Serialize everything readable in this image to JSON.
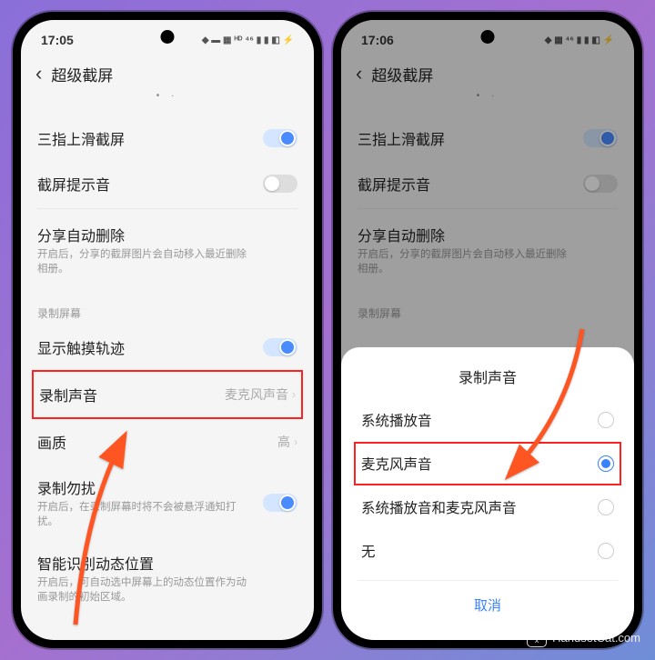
{
  "watermark": "HandsetCat.com",
  "phone1": {
    "time": "17:05",
    "header_title": "超级截屏",
    "rows": {
      "swipe": {
        "label": "三指上滑截屏",
        "on": true
      },
      "sound": {
        "label": "截屏提示音",
        "on": false
      },
      "share_delete": {
        "label": "分享自动删除",
        "desc": "开启后，分享的截屏图片会自动移入最近删除相册。"
      },
      "section": "录制屏幕",
      "trace": {
        "label": "显示触摸轨迹",
        "on": true
      },
      "record_sound": {
        "label": "录制声音",
        "value": "麦克风声音"
      },
      "quality": {
        "label": "画质",
        "value": "高"
      },
      "dnd": {
        "label": "录制勿扰",
        "desc": "开启后，在录制屏幕时将不会被悬浮通知打扰。",
        "on": true
      },
      "smart": {
        "label": "智能识别动态位置",
        "desc": "开启后，可自动选中屏幕上的动态位置作为动画录制的初始区域。"
      }
    }
  },
  "phone2": {
    "time": "17:06",
    "header_title": "超级截屏",
    "rows": {
      "swipe": {
        "label": "三指上滑截屏",
        "on": true
      },
      "sound": {
        "label": "截屏提示音",
        "on": false
      },
      "share_delete": {
        "label": "分享自动删除",
        "desc": "开启后，分享的截屏图片会自动移入最近删除相册。"
      },
      "section": "录制屏幕"
    },
    "sheet": {
      "title": "录制声音",
      "opt1": "系统播放音",
      "opt2": "麦克风声音",
      "opt3": "系统播放音和麦克风声音",
      "opt4": "无",
      "cancel": "取消"
    }
  }
}
